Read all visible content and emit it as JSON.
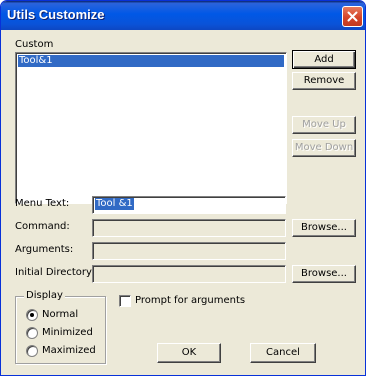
{
  "window": {
    "title": "Utils Customize"
  },
  "custom": {
    "label": "Custom",
    "items": [
      "Tool&1"
    ]
  },
  "buttons": {
    "add": "Add",
    "remove": "Remove",
    "move_up": "Move Up",
    "move_down": "Move Down",
    "browse_command": "Browse...",
    "browse_dir": "Browse...",
    "ok": "OK",
    "cancel": "Cancel"
  },
  "fields": {
    "menu_text": {
      "label": "Menu Text:",
      "value": "Tool &1"
    },
    "command": {
      "label": "Command:",
      "value": ""
    },
    "arguments": {
      "label": "Arguments:",
      "value": ""
    },
    "initial_directory": {
      "label": "Initial Directory:",
      "value": ""
    }
  },
  "display": {
    "label": "Display",
    "options": [
      "Normal",
      "Minimized",
      "Maximized"
    ],
    "selected": "Normal"
  },
  "prompt_args": {
    "label": "Prompt for arguments",
    "checked": false
  },
  "colors": {
    "title_bar": "#0058e6",
    "selection": "#316ac5",
    "dialog_bg": "#ece9d8",
    "close_button": "#d4452a"
  }
}
